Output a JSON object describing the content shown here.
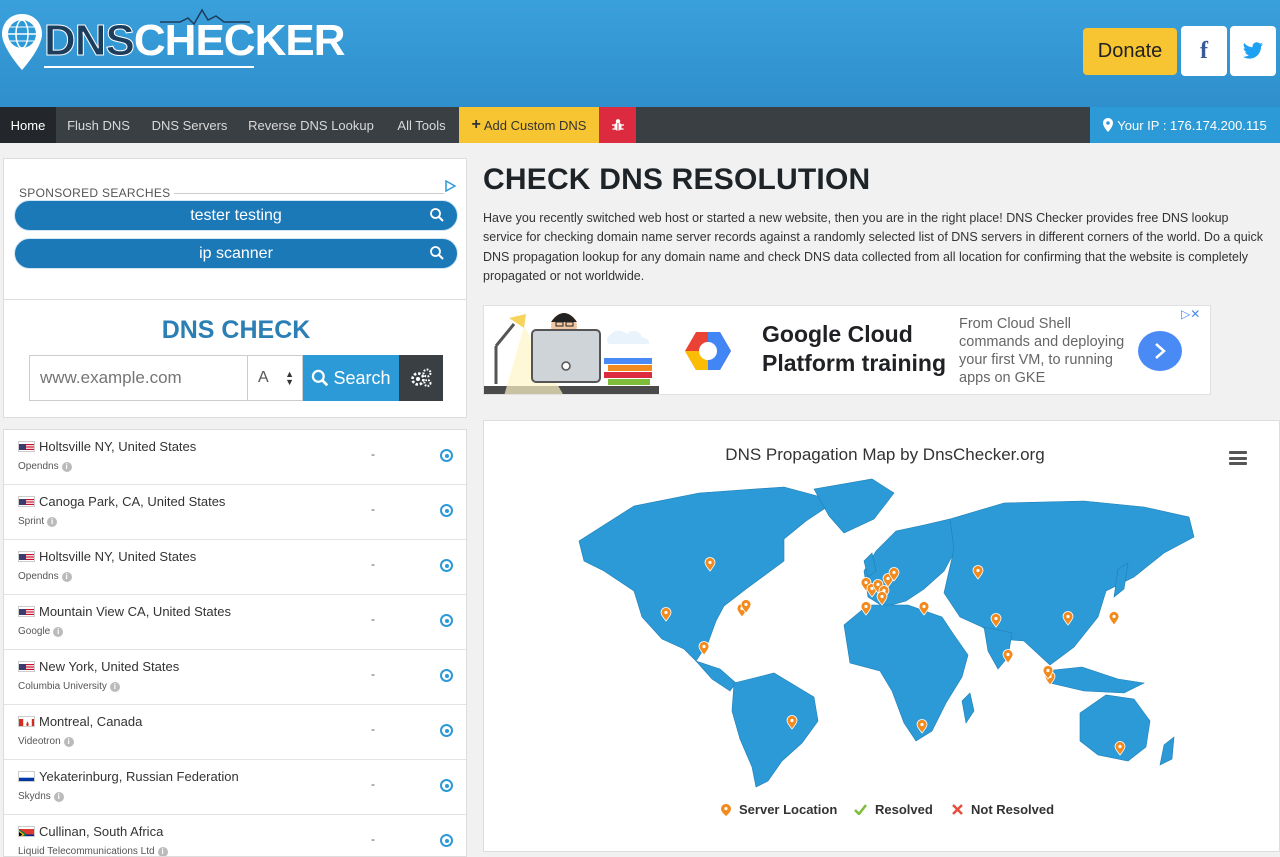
{
  "header": {
    "logo_part1": "DNS",
    "logo_part2": "CHECKER",
    "donate_label": "Donate",
    "facebook_label": "f",
    "twitter_icon": "twitter-bird-icon"
  },
  "nav": {
    "items": [
      {
        "label": "Home"
      },
      {
        "label": "Flush DNS"
      },
      {
        "label": "DNS Servers"
      },
      {
        "label": "Reverse DNS Lookup"
      },
      {
        "label": "All Tools"
      },
      {
        "label": "Add Custom DNS"
      }
    ],
    "bug_icon": "bug-icon",
    "ip_label": "Your IP : 176.174.200.115"
  },
  "sponsored": {
    "label": "SPONSORED SEARCHES",
    "items": [
      {
        "label": "tester testing"
      },
      {
        "label": "ip scanner"
      }
    ]
  },
  "dns_check": {
    "title": "DNS CHECK",
    "placeholder": "www.example.com",
    "record_type": "A",
    "search_label": "Search"
  },
  "servers": [
    {
      "flag": "us",
      "location": "Holtsville NY, United States",
      "provider": "Opendns",
      "result": "-"
    },
    {
      "flag": "us",
      "location": "Canoga Park, CA, United States",
      "provider": "Sprint",
      "result": "-"
    },
    {
      "flag": "us",
      "location": "Holtsville NY, United States",
      "provider": "Opendns",
      "result": "-"
    },
    {
      "flag": "us",
      "location": "Mountain View CA, United States",
      "provider": "Google",
      "result": "-"
    },
    {
      "flag": "us",
      "location": "New York, United States",
      "provider": "Columbia University",
      "result": "-"
    },
    {
      "flag": "ca",
      "location": "Montreal, Canada",
      "provider": "Videotron",
      "result": "-"
    },
    {
      "flag": "ru",
      "location": "Yekaterinburg, Russian Federation",
      "provider": "Skydns",
      "result": "-"
    },
    {
      "flag": "za",
      "location": "Cullinan, South Africa",
      "provider": "Liquid Telecommunications Ltd",
      "result": "-"
    }
  ],
  "main": {
    "title": "CHECK DNS RESOLUTION",
    "intro": "Have you recently switched web host or started a new website, then you are in the right place! DNS Checker provides free DNS lookup service for checking domain name server records against a randomly selected list of DNS servers in different corners of the world. Do a quick DNS propagation lookup for any domain name and check DNS data collected from all location for confirming that the website is completely propagated or not worldwide."
  },
  "ad": {
    "title": "Google Cloud Platform training",
    "description": "From Cloud Shell commands and deploying your first VM, to running apps on GKE"
  },
  "map": {
    "title": "DNS Propagation Map by DnsChecker.org",
    "legend": {
      "server": "Server Location",
      "resolved": "Resolved",
      "not_resolved": "Not Resolved"
    },
    "colors": {
      "land": "#2c9ad6",
      "marker": "#f28a1e",
      "resolved": "#7dbd3a",
      "not_resolved": "#e74c3c"
    }
  }
}
